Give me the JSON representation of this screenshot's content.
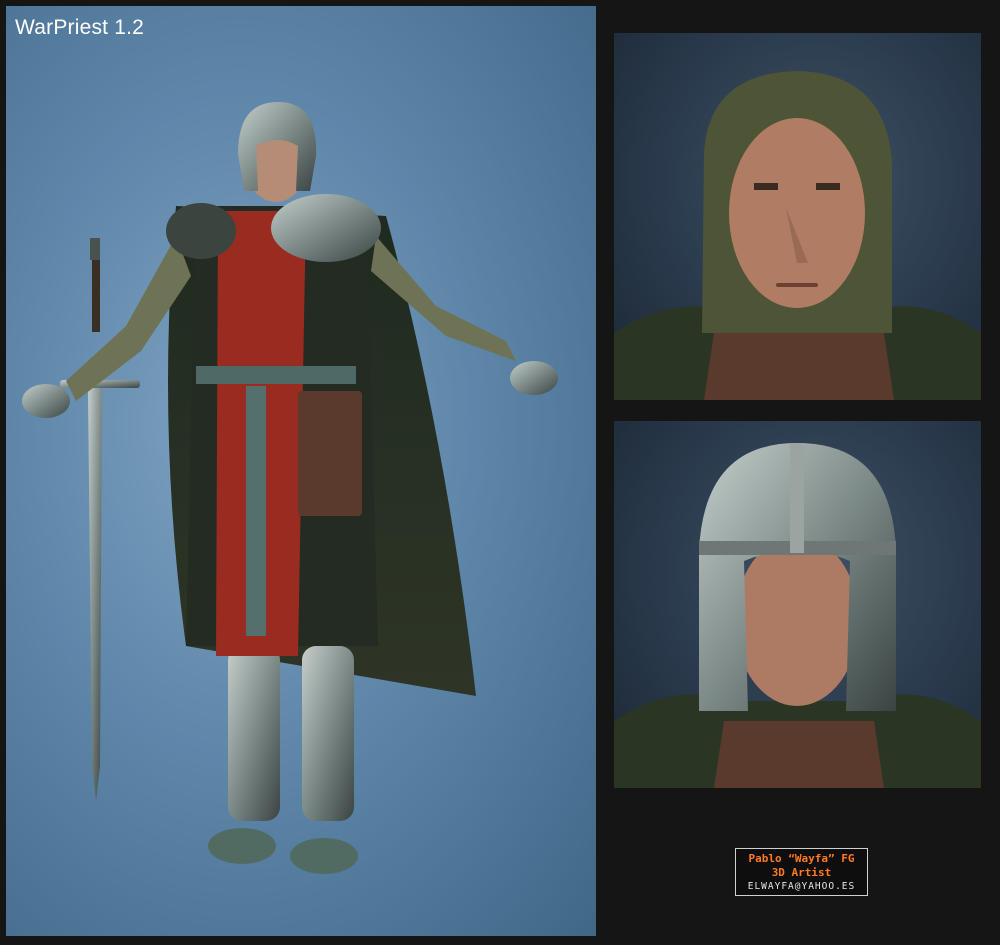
{
  "title": "WarPriest 1.2",
  "credit": {
    "name": "Pablo “Wayfa” FG",
    "role": "3D Artist",
    "email": "ELWAYFA@YAHOO.ES"
  },
  "colors": {
    "page_background": "#151516",
    "main_background": "#5f87aa",
    "portrait_background": "#28384a",
    "credit_text": "#ff7a22",
    "tabard_red": "#9a2b20",
    "armor_steel": "#8e9a97"
  },
  "images": {
    "main": "full-body-knight-render",
    "face": "hooded-face-closeup",
    "helmet": "helmeted-face-closeup"
  }
}
